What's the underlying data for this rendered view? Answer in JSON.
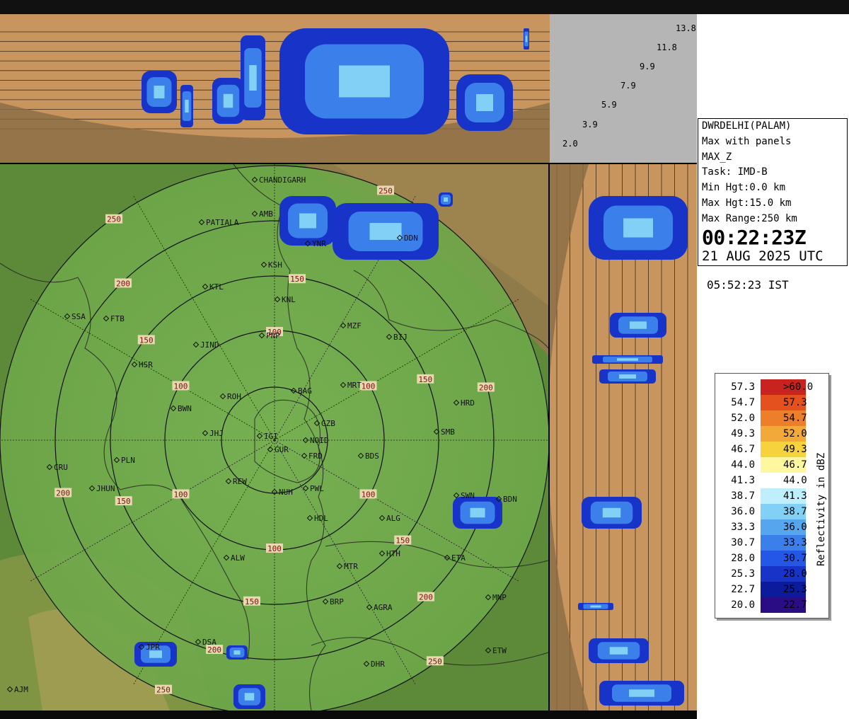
{
  "radar": {
    "station": "DWRDELHI(PALAM)",
    "product": "Max with panels",
    "field": "MAX_Z",
    "task": "Task: IMD-B",
    "min_hgt": "Min Hgt:0.0 km",
    "max_hgt": "Max Hgt:15.0 km",
    "max_range": "Max Range:250 km",
    "time_utc": "00:22:23Z",
    "date": "21 AUG 2025 UTC",
    "time_ist": "05:52:23 IST"
  },
  "height_scale": [
    "13.8",
    "11.8",
    "9.9",
    "7.9",
    "5.9",
    "3.9",
    "2.0"
  ],
  "legend": {
    "title": "Reflectivity in dBZ",
    "rows": [
      {
        "lo": "57.3",
        "hi": ">60.0",
        "color": "#c8231e"
      },
      {
        "lo": "54.7",
        "hi": "57.3",
        "color": "#e4501e"
      },
      {
        "lo": "52.0",
        "hi": "54.7",
        "color": "#ee7f2a"
      },
      {
        "lo": "49.3",
        "hi": "52.0",
        "color": "#f2a93a"
      },
      {
        "lo": "46.7",
        "hi": "49.3",
        "color": "#f6d23c"
      },
      {
        "lo": "44.0",
        "hi": "46.7",
        "color": "#fdf7a0"
      },
      {
        "lo": "41.3",
        "hi": "44.0",
        "color": "#ffffff"
      },
      {
        "lo": "38.7",
        "hi": "41.3",
        "color": "#bfeffc"
      },
      {
        "lo": "36.0",
        "hi": "38.7",
        "color": "#82d0f5"
      },
      {
        "lo": "33.3",
        "hi": "36.0",
        "color": "#56a6ee"
      },
      {
        "lo": "30.7",
        "hi": "33.3",
        "color": "#3a7fea"
      },
      {
        "lo": "28.0",
        "hi": "30.7",
        "color": "#2557e6"
      },
      {
        "lo": "25.3",
        "hi": "28.0",
        "color": "#1733c8"
      },
      {
        "lo": "22.7",
        "hi": "25.3",
        "color": "#0c1a9c"
      },
      {
        "lo": "20.0",
        "hi": "22.7",
        "color": "#2a0d84"
      }
    ]
  },
  "range_rings": [
    "100",
    "150",
    "200",
    "250"
  ],
  "cities": [
    "CHANDIGARH",
    "PATIALA",
    "AMB",
    "DDN",
    "YNR",
    "KSH",
    "KTL",
    "KNL",
    "SSA",
    "FTB",
    "MZF",
    "BIJ",
    "JIND",
    "PNP",
    "HSR",
    "BAG",
    "MRT",
    "HRD",
    "ROH",
    "BWN",
    "JHJ",
    "IGI",
    "GZB",
    "NOID",
    "GUR",
    "FRD",
    "BDS",
    "SMB",
    "CRU",
    "PLN",
    "JHUN",
    "REW",
    "NUH",
    "PWL",
    "SWN",
    "BDN",
    "HDL",
    "ALG",
    "ALW",
    "HTH",
    "ETA",
    "MTR",
    "BRP",
    "AGRA",
    "MNP",
    "JPR",
    "DSA",
    "ETW",
    "DHR",
    "AJM"
  ],
  "colors": {
    "terrain": "#5f8f3a",
    "panel": "#c9955e",
    "grid": "#1a1a1a",
    "echo": "#2557e6"
  }
}
